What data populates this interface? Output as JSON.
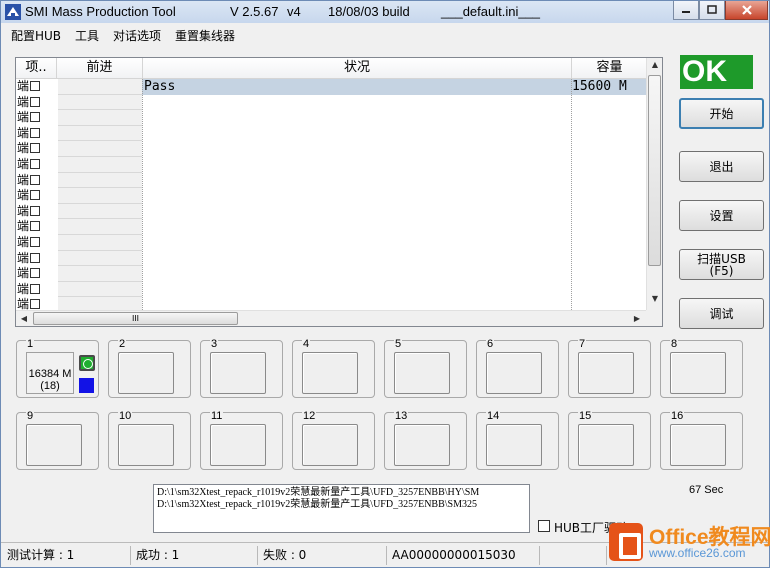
{
  "titlebar": {
    "app_name": "SMI Mass Production Tool",
    "version": "V 2.5.67",
    "variant": "v4",
    "build": "18/08/03 build",
    "ini": "___default.ini___"
  },
  "menu": [
    "配置HUB",
    "工具",
    "对话选项",
    "重置集线器"
  ],
  "list": {
    "columns": [
      "项..",
      "前进",
      "状况",
      "容量"
    ],
    "port_label": "端",
    "rows_visible": 15,
    "selected_row": {
      "status": "Pass",
      "capacity": "15600 M"
    },
    "hscroll_grip": "III"
  },
  "status_indicator": "OK",
  "buttons": {
    "start": "开始",
    "exit": "退出",
    "settings": "设置",
    "scan_usb_line1": "扫描USB",
    "scan_usb_line2": "(F5)",
    "debug": "调试"
  },
  "ports": [
    {
      "num": "1",
      "capacity": "16384 M",
      "sub": "(18)"
    },
    {
      "num": "2"
    },
    {
      "num": "3"
    },
    {
      "num": "4"
    },
    {
      "num": "5"
    },
    {
      "num": "6"
    },
    {
      "num": "7"
    },
    {
      "num": "8"
    },
    {
      "num": "9"
    },
    {
      "num": "10"
    },
    {
      "num": "11"
    },
    {
      "num": "12"
    },
    {
      "num": "13"
    },
    {
      "num": "14"
    },
    {
      "num": "15"
    },
    {
      "num": "16"
    }
  ],
  "log_lines": [
    "D:\\1\\sm32Xtest_repack_r1019v2荣慧最新量产工具\\UFD_3257ENBB\\HY\\SM",
    "D:\\1\\sm32Xtest_repack_r1019v2荣慧最新量产工具\\UFD_3257ENBB\\SM325"
  ],
  "timer": "67 Sec",
  "hub_driver_label": "HUB工厂驱动",
  "statusbar": {
    "test_count": "测试计算 : 1",
    "success": "成功 : 1",
    "fail": "失败 : 0",
    "serial": "AA00000000015030"
  },
  "watermark": {
    "title": "Office教程网",
    "url": "www.office26.com"
  },
  "colors": {
    "ok_green": "#1e9a2a",
    "led_green": "#1fae2f",
    "led_blue": "#1212e6",
    "selected_row": "#c5d3e2"
  }
}
